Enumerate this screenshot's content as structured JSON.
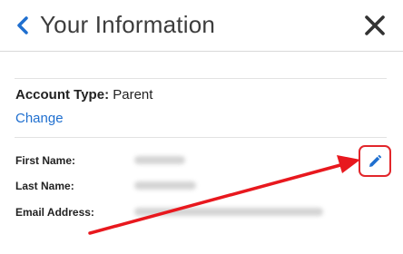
{
  "header": {
    "title": "Your Information",
    "back_icon": "chevron-left-icon",
    "close_icon": "close-icon",
    "accent_color": "#1f6fcf"
  },
  "account": {
    "type_label": "Account Type:",
    "type_value": "Parent",
    "change_link": "Change"
  },
  "fields": [
    {
      "label": "First Name:"
    },
    {
      "label": "Last Name:"
    },
    {
      "label": "Email Address:"
    }
  ],
  "edit_button": {
    "icon": "pencil-icon",
    "highlight_color": "#e2262b"
  }
}
